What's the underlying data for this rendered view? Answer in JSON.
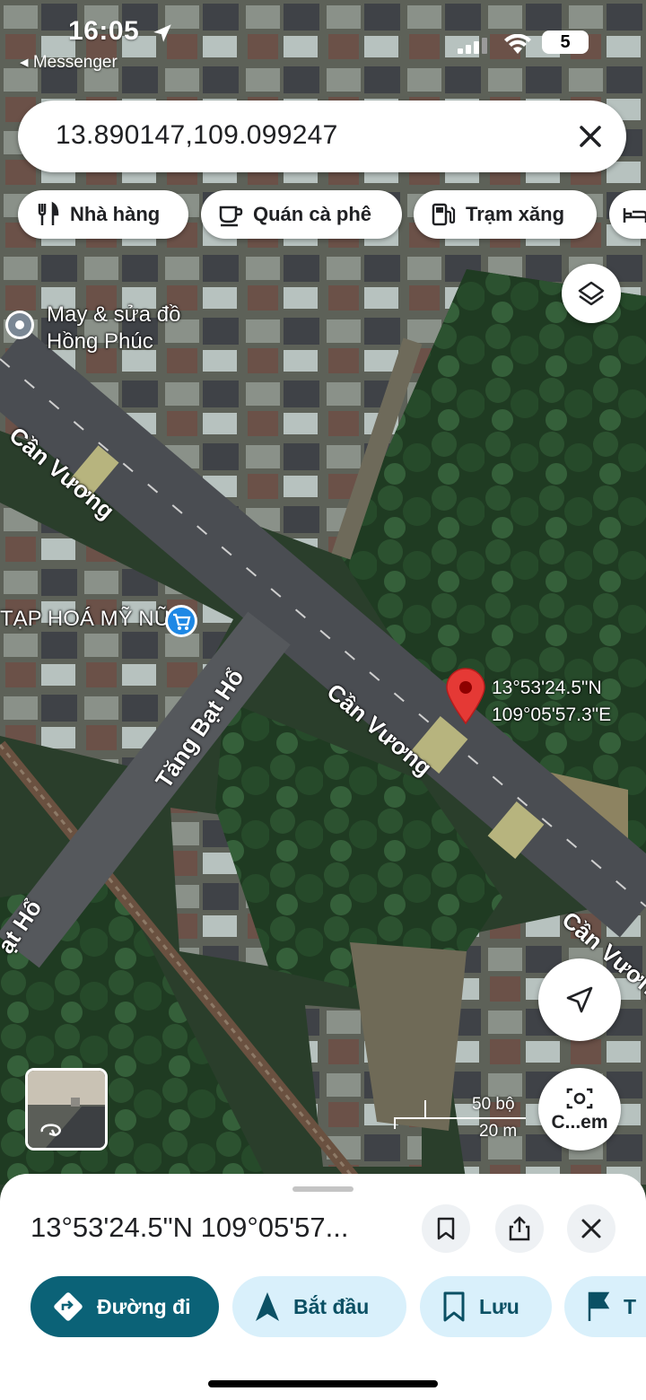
{
  "status_bar": {
    "time": "16:05",
    "back_app": "◂ Messenger",
    "battery": "5"
  },
  "search": {
    "query": "13.890147,109.099247"
  },
  "chips": [
    {
      "label": "Nhà hàng",
      "icon": "fork-knife-icon"
    },
    {
      "label": "Quán cà phê",
      "icon": "coffee-cup-icon"
    },
    {
      "label": "Trạm xăng",
      "icon": "gas-pump-icon"
    },
    {
      "label": "",
      "icon": "bed-icon"
    }
  ],
  "map": {
    "places": [
      {
        "name": "May & sửa đồ\nHồng Phúc",
        "icon": "place-pin-icon"
      },
      {
        "name": "TẠP HOÁ MỸ NỮ",
        "icon": "shopping-cart-icon"
      }
    ],
    "roads": [
      "Cần Vương",
      "Cần Vương",
      "Cần Vương",
      "Tăng Bạt Hổ",
      "ạt Hổ"
    ],
    "pin": {
      "lat": "13°53'24.5\"N",
      "lng": "109°05'57.3\"E"
    },
    "scale": {
      "imperial": "50 bộ",
      "metric": "20 m"
    },
    "camera_label": "C...em"
  },
  "sheet": {
    "title": "13°53'24.5\"N 109°05'57...",
    "actions": [
      {
        "label": "Đường đi",
        "icon": "directions-icon"
      },
      {
        "label": "Bắt đầu",
        "icon": "navigation-arrow-icon"
      },
      {
        "label": "Lưu",
        "icon": "bookmark-icon"
      },
      {
        "label": "T",
        "icon": "flag-icon"
      }
    ]
  },
  "colors": {
    "primary": "#0b6277",
    "secondary_bg": "#d9f0fb",
    "pin_red": "#e53935",
    "road": "#4a4d52"
  }
}
